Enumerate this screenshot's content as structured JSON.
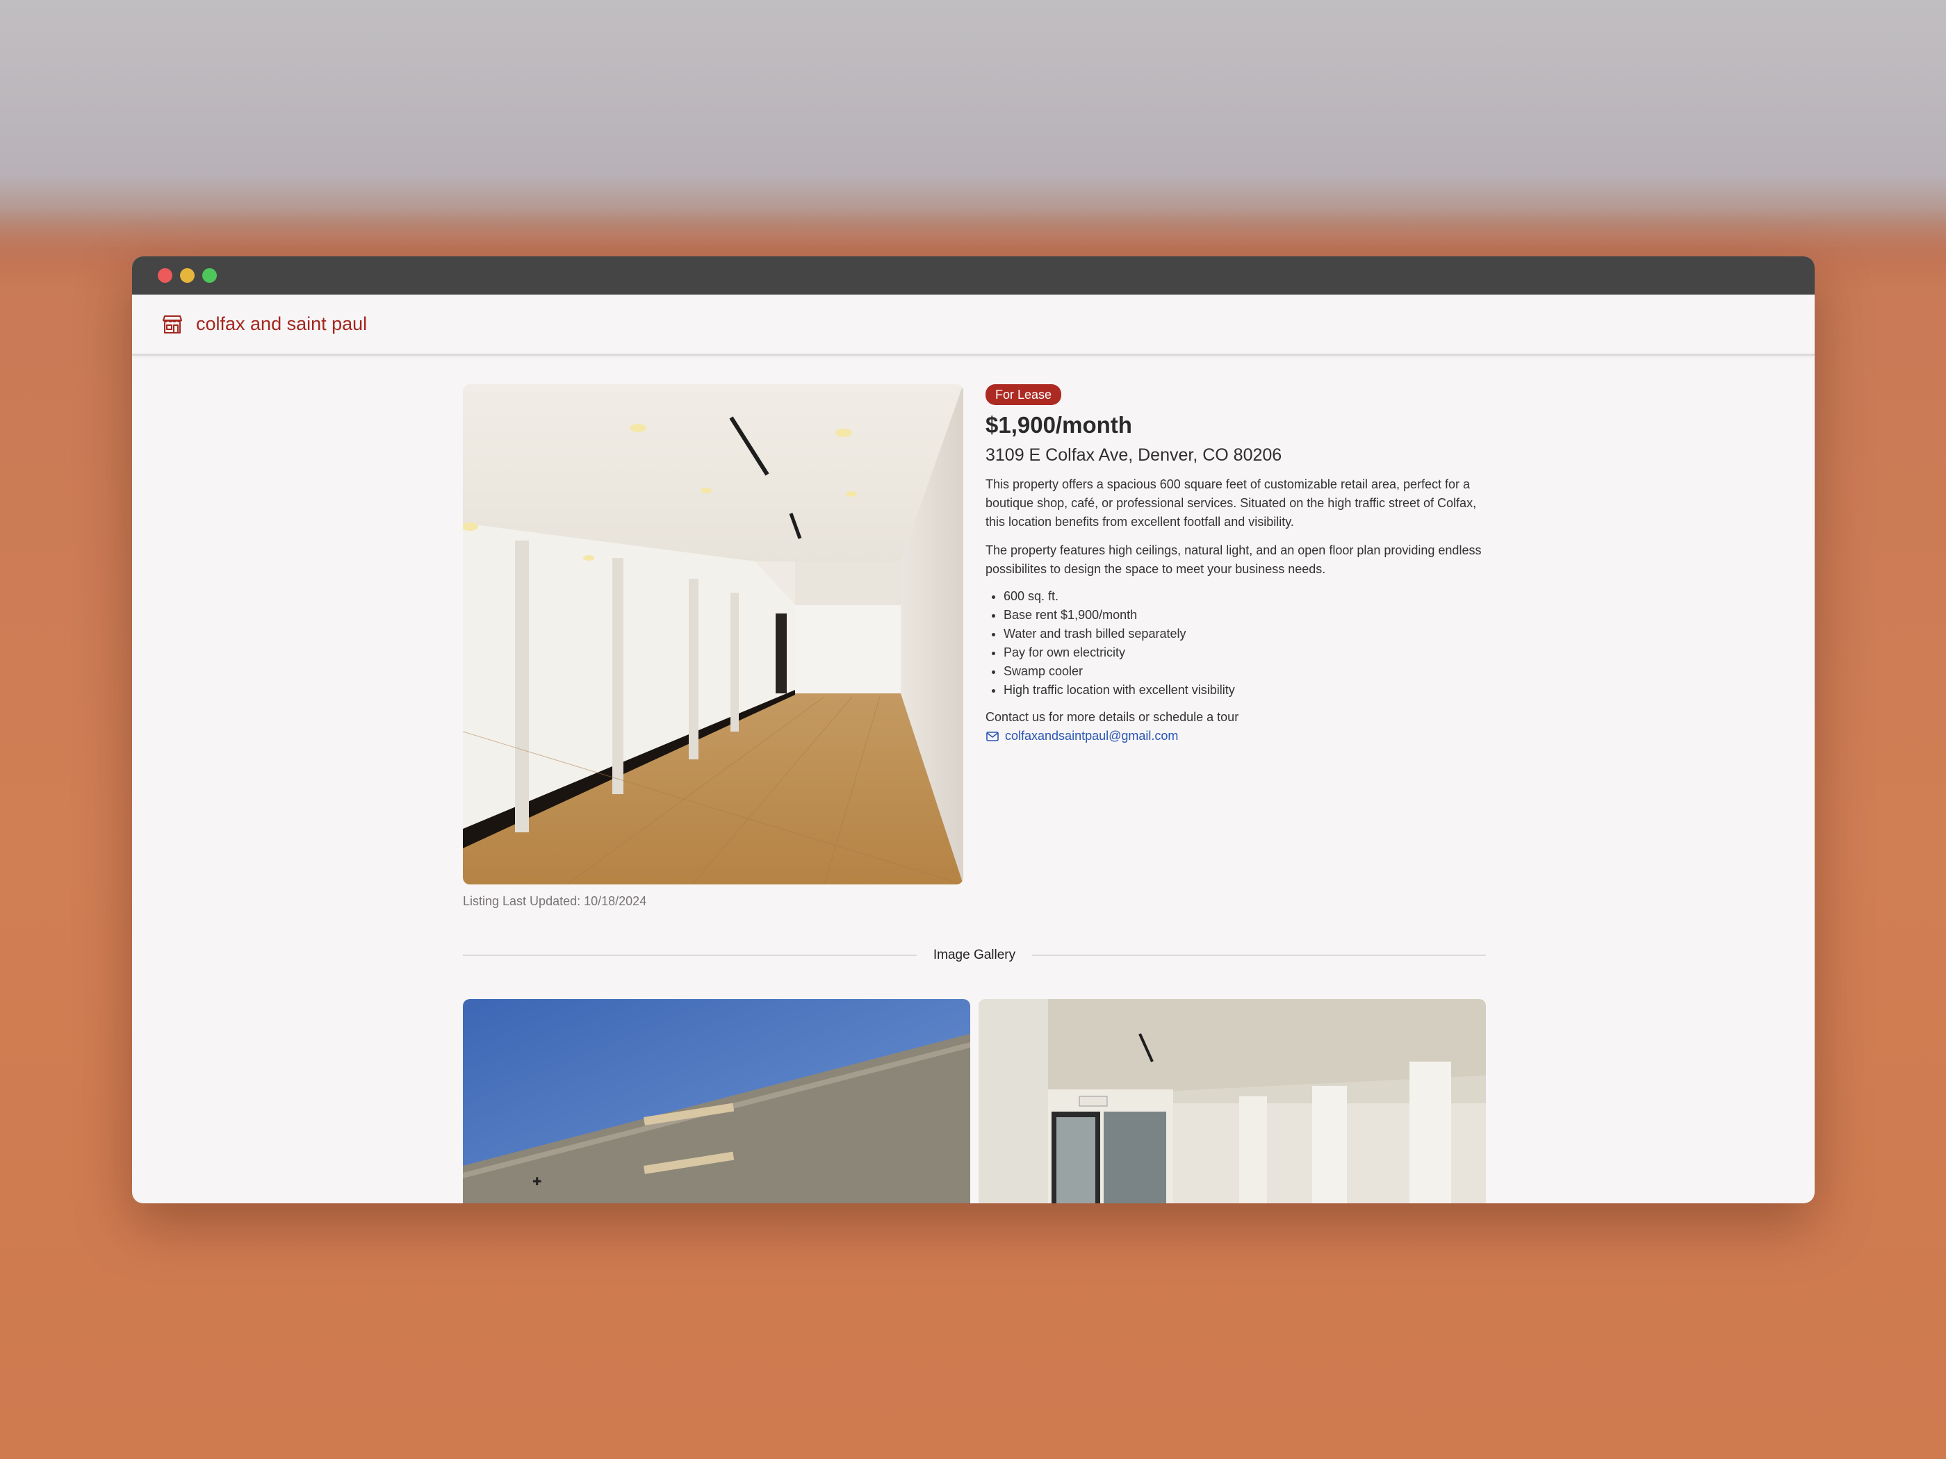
{
  "site": {
    "name": "colfax and saint paul",
    "icon": "storefront-icon"
  },
  "listing": {
    "status": "For Lease",
    "price": "$1,900/month",
    "address": "3109 E Colfax Ave, Denver, CO 80206",
    "description_1": "This property offers a spacious 600 square feet of customizable retail area, perfect for a boutique shop, café, or professional services. Situated on the high traffic street of Colfax, this location benefits from excellent footfall and visibility.",
    "description_2": "The property features high ceilings, natural light, and an open floor plan providing endless possibilites to design the space to meet your business needs.",
    "features": [
      "600 sq. ft.",
      "Base rent $1,900/month",
      "Water and trash billed separately",
      "Pay for own electricity",
      "Swamp cooler",
      "High traffic location with excellent visibility"
    ],
    "contact_text": "Contact us for more details or schedule a tour",
    "email": "colfaxandsaintpaul@gmail.com",
    "last_updated": "Listing Last Updated: 10/18/2024"
  },
  "gallery": {
    "title": "Image Gallery"
  },
  "colors": {
    "brand": "#a3271f",
    "badge": "#ad2a23",
    "link": "#2a55b3"
  }
}
